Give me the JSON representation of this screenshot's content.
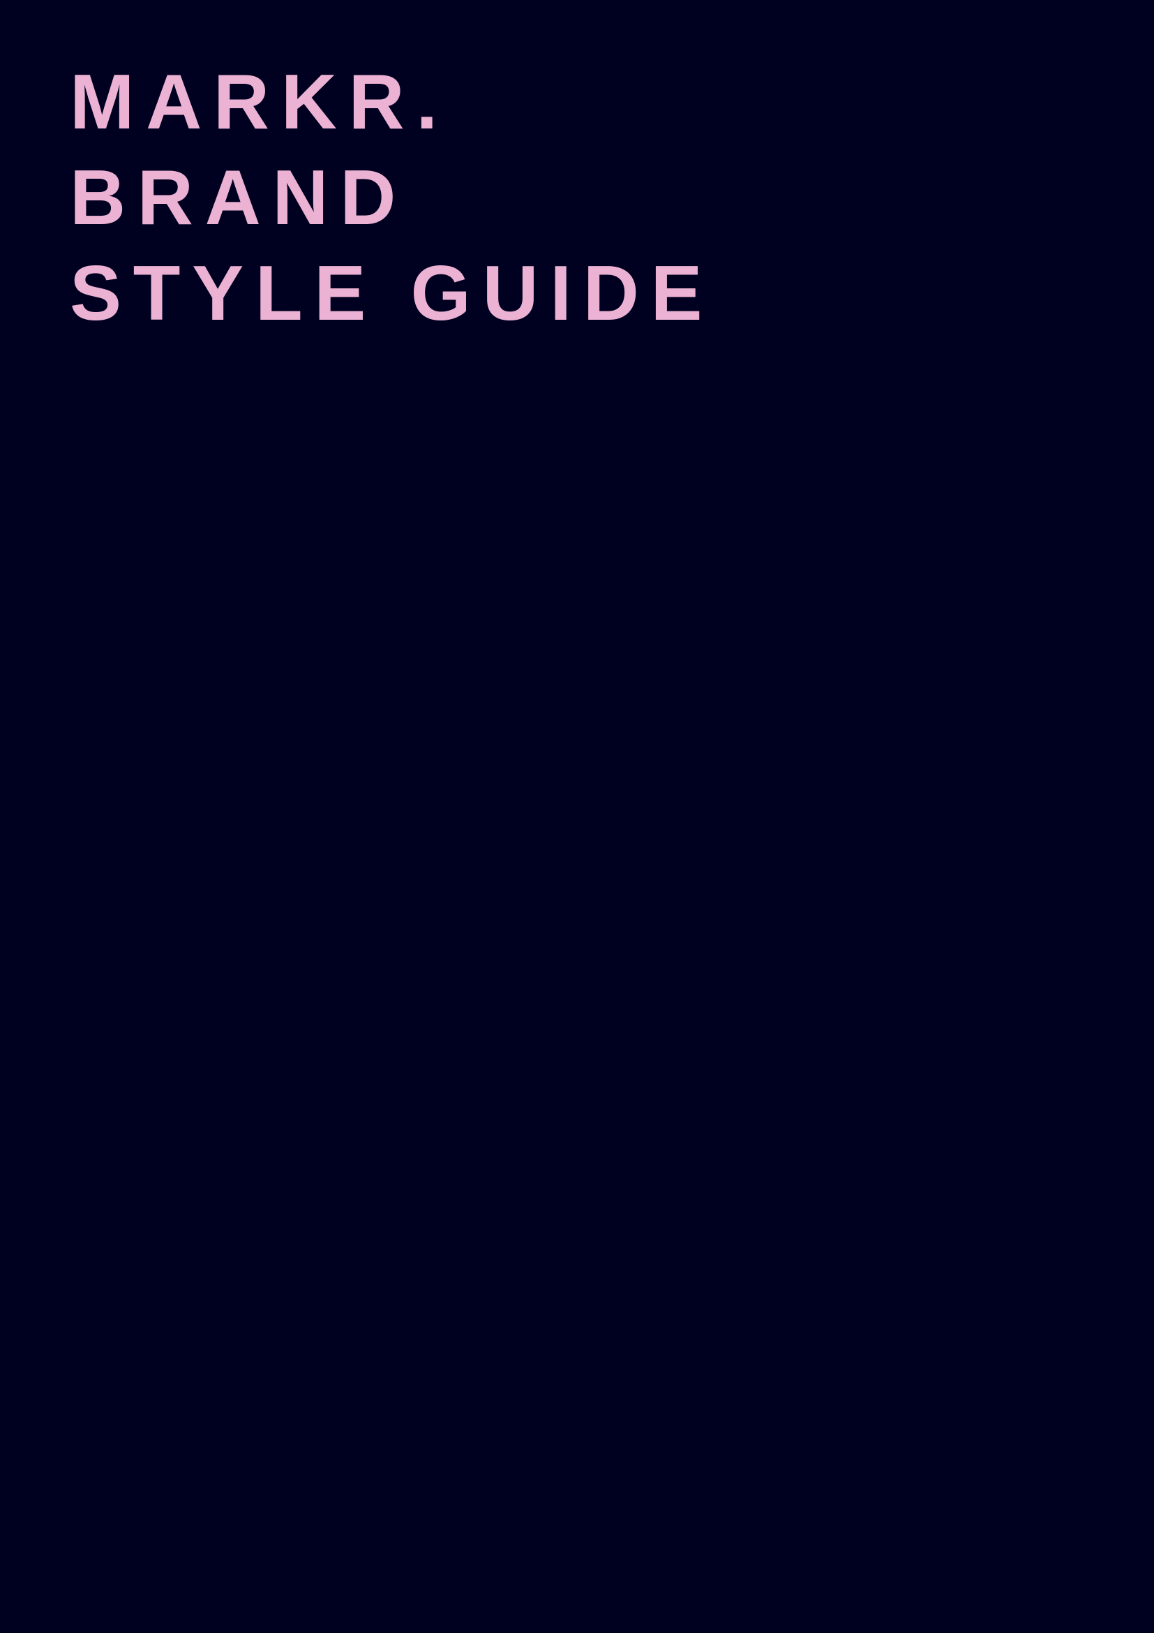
{
  "cover": {
    "title_lines": [
      "MARKR.",
      "BRAND",
      "STYLE GUIDE"
    ],
    "colors": {
      "background": "#000020",
      "text": "#ecb2d3"
    }
  }
}
